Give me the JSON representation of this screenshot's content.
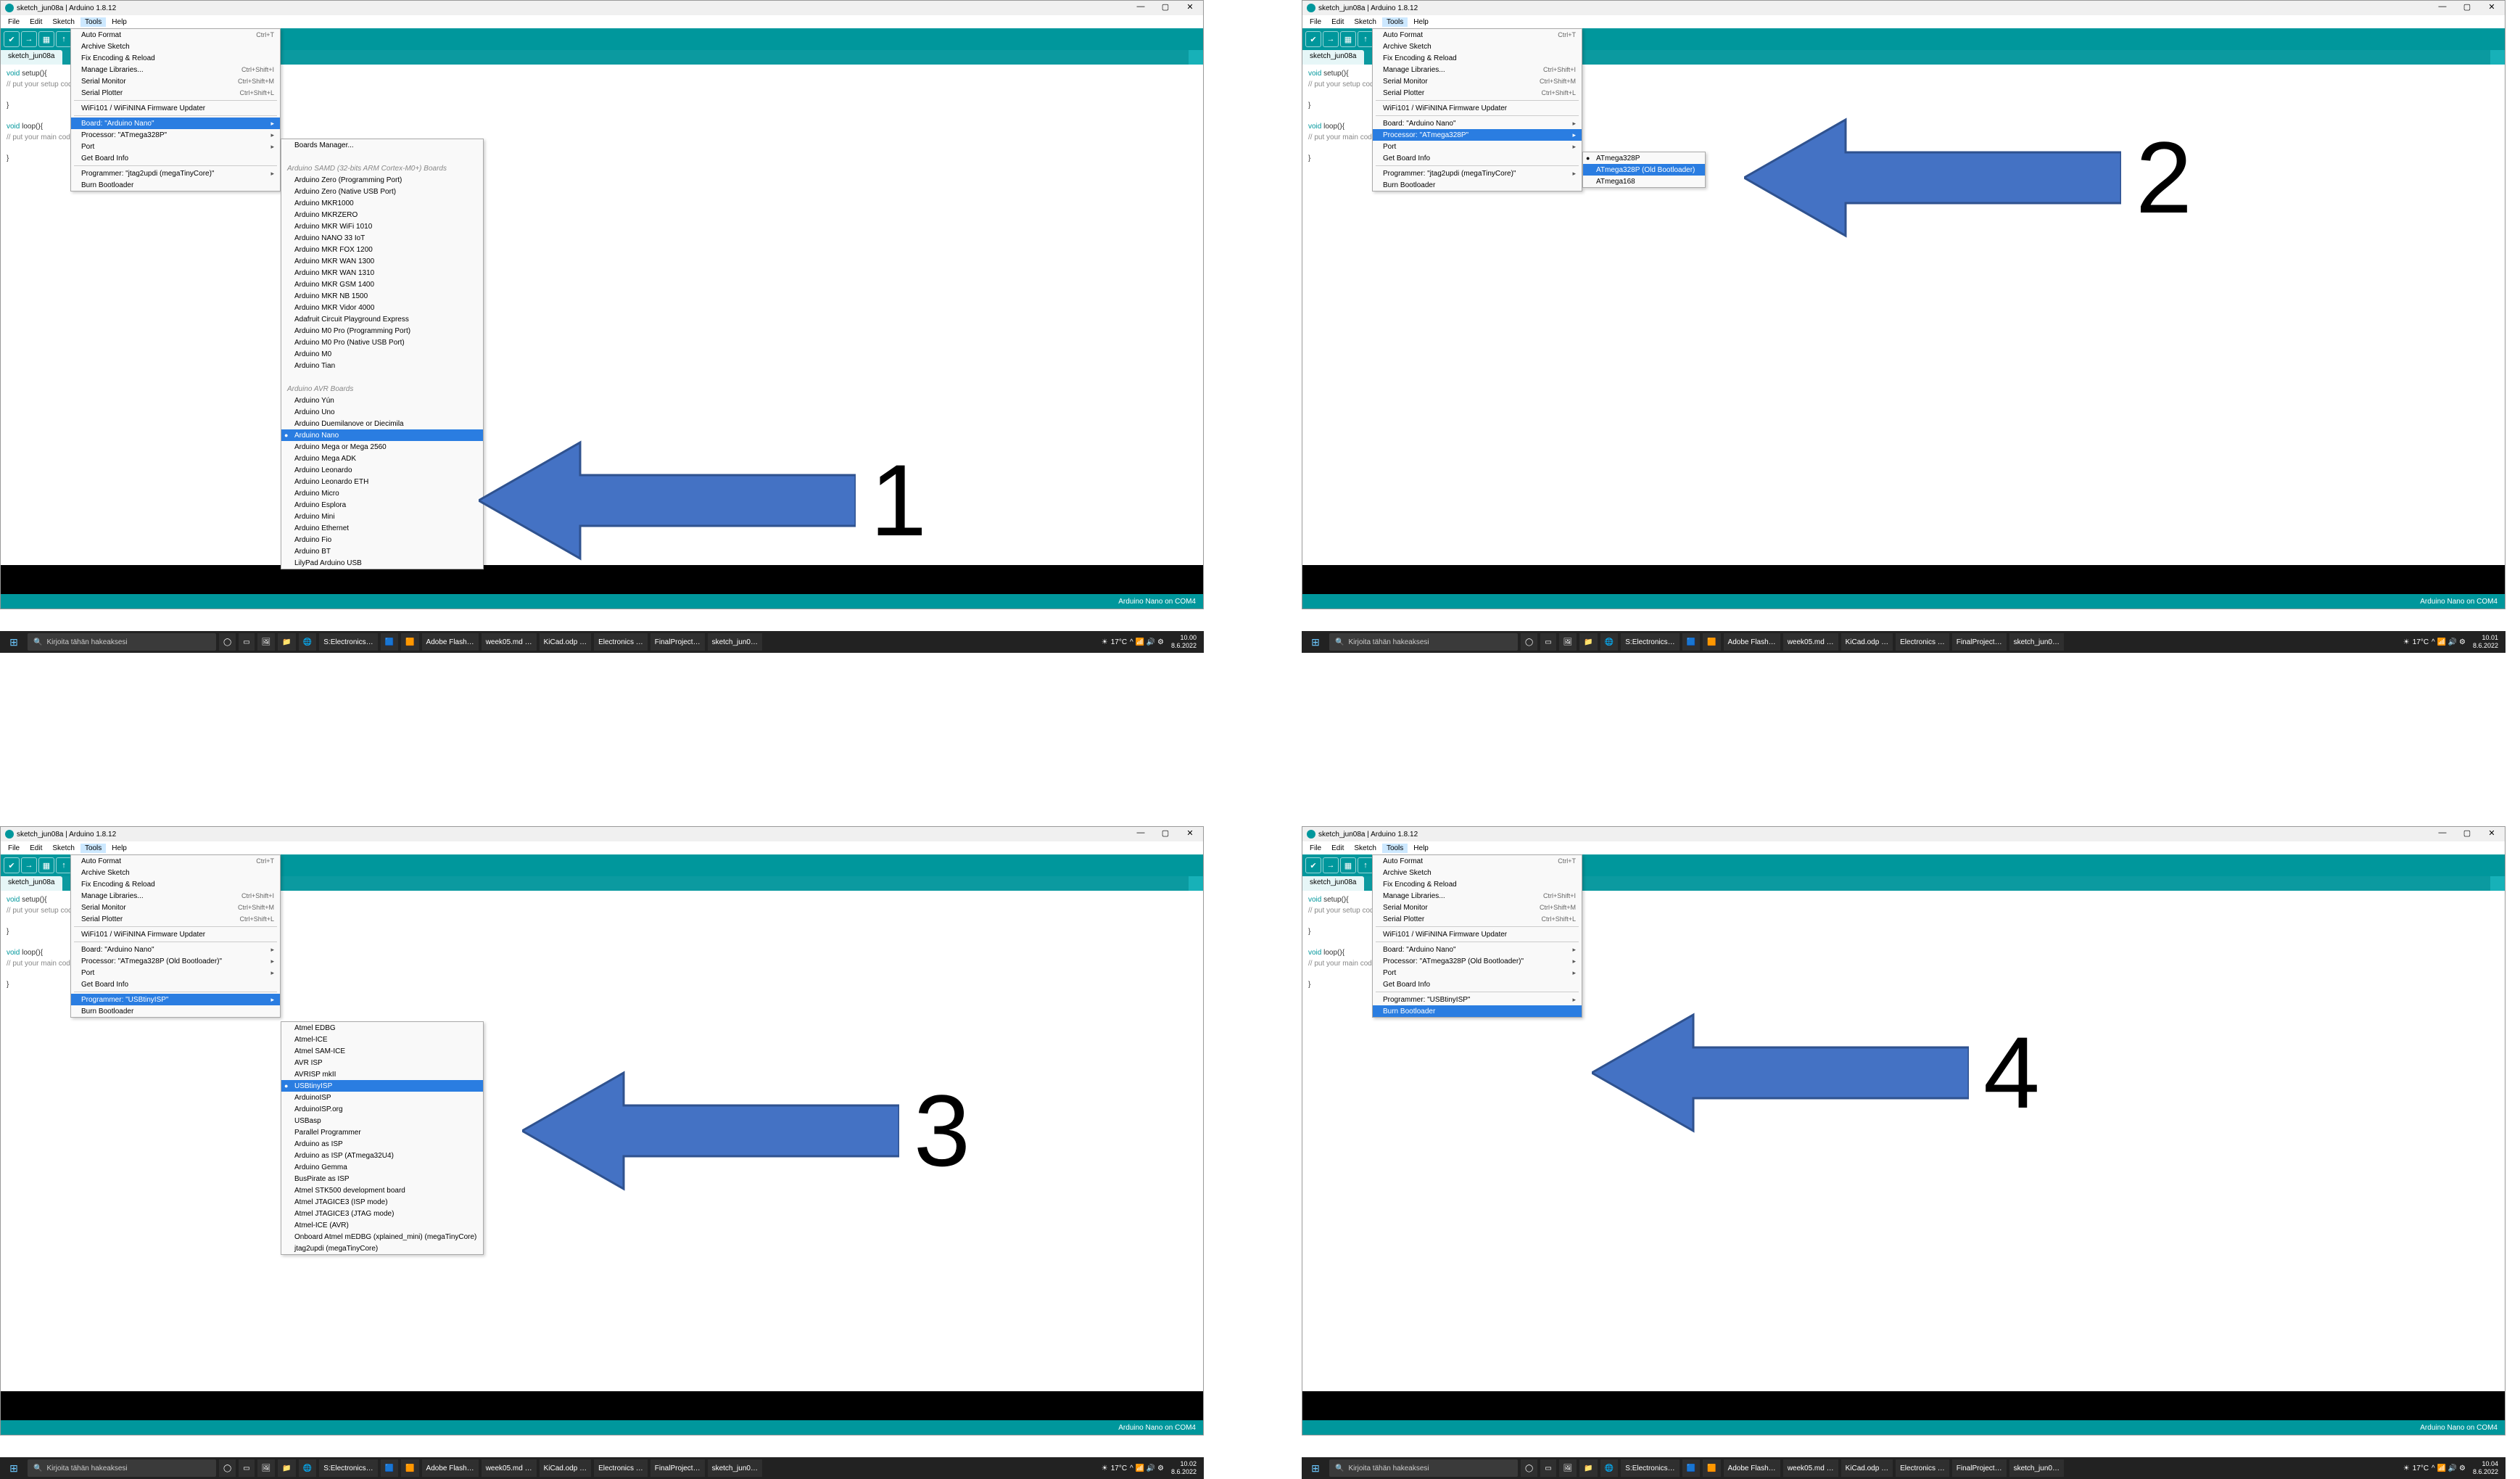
{
  "app_title": "sketch_jun08a | Arduino 1.8.12",
  "menubar": [
    "File",
    "Edit",
    "Sketch",
    "Tools",
    "Help"
  ],
  "menubar_hi": "Tools",
  "tab_label": "sketch_jun08a",
  "status_text": "Arduino Nano on COM4",
  "code": {
    "l1a": "void ",
    "l1b": "setup()",
    "l1c": "{",
    "l2": "  // put your setup code here, to run once:",
    "l3": "",
    "l4": "}",
    "l5": "",
    "l6a": "void ",
    "l6b": "loop()",
    "l6c": "{",
    "l7": "  // put your main code here, to run repeatedly:",
    "l8": "",
    "l9": "}"
  },
  "tools_common": {
    "auto_format": "Auto Format",
    "auto_format_sc": "Ctrl+T",
    "archive": "Archive Sketch",
    "fix_enc": "Fix Encoding & Reload",
    "manage_lib": "Manage Libraries...",
    "manage_lib_sc": "Ctrl+Shift+I",
    "ser_mon": "Serial Monitor",
    "ser_mon_sc": "Ctrl+Shift+M",
    "ser_plot": "Serial Plotter",
    "ser_plot_sc": "Ctrl+Shift+L",
    "wifi": "WiFi101 / WiFiNINA Firmware Updater",
    "port": "Port",
    "get_board": "Get Board Info",
    "burn": "Burn Bootloader"
  },
  "panel1": {
    "board": "Board: \"Arduino Nano\"",
    "processor": "Processor: \"ATmega328P\"",
    "programmer": "Programmer: \"jtag2updi (megaTinyCore)\"",
    "sub_hdr1": "Boards Manager...",
    "sub_hdr2": "Arduino SAMD (32-bits ARM Cortex-M0+) Boards",
    "sub_hdr3": "Arduino AVR Boards",
    "samd": [
      "Arduino Zero (Programming Port)",
      "Arduino Zero (Native USB Port)",
      "Arduino MKR1000",
      "Arduino MKRZERO",
      "Arduino MKR WiFi 1010",
      "Arduino NANO 33 IoT",
      "Arduino MKR FOX 1200",
      "Arduino MKR WAN 1300",
      "Arduino MKR WAN 1310",
      "Arduino MKR GSM 1400",
      "Arduino MKR NB 1500",
      "Arduino MKR Vidor 4000",
      "Adafruit Circuit Playground Express",
      "Arduino M0 Pro (Programming Port)",
      "Arduino M0 Pro (Native USB Port)",
      "Arduino M0",
      "Arduino Tian"
    ],
    "avr": [
      "Arduino Yún",
      "Arduino Uno",
      "Arduino Duemilanove or Diecimila",
      "Arduino Nano",
      "Arduino Mega or Mega 2560",
      "Arduino Mega ADK",
      "Arduino Leonardo",
      "Arduino Leonardo ETH",
      "Arduino Micro",
      "Arduino Esplora",
      "Arduino Mini",
      "Arduino Ethernet",
      "Arduino Fio",
      "Arduino BT",
      "LilyPad Arduino USB"
    ],
    "avr_hi": "Arduino Nano"
  },
  "panel2": {
    "board": "Board: \"Arduino Nano\"",
    "processor": "Processor: \"ATmega328P\"",
    "programmer": "Programmer: \"jtag2updi (megaTinyCore)\"",
    "sub": [
      "ATmega328P",
      "ATmega328P (Old Bootloader)",
      "ATmega168"
    ],
    "sub_hi": "ATmega328P (Old Bootloader)",
    "sub_chk": "ATmega328P"
  },
  "panel3": {
    "board": "Board: \"Arduino Nano\"",
    "processor": "Processor: \"ATmega328P (Old Bootloader)\"",
    "programmer": "Programmer: \"USBtinyISP\"",
    "sub": [
      "Atmel EDBG",
      "Atmel-ICE",
      "Atmel SAM-ICE",
      "AVR ISP",
      "AVRISP mkII",
      "USBtinyISP",
      "ArduinoISP",
      "ArduinoISP.org",
      "USBasp",
      "Parallel Programmer",
      "Arduino as ISP",
      "Arduino as ISP (ATmega32U4)",
      "Arduino Gemma",
      "BusPirate as ISP",
      "Atmel STK500 development board",
      "Atmel JTAGICE3 (ISP mode)",
      "Atmel JTAGICE3 (JTAG mode)",
      "Atmel-ICE (AVR)",
      "Onboard Atmel mEDBG (xplained_mini) (megaTinyCore)",
      "jtag2updi (megaTinyCore)"
    ],
    "sub_hi": "USBtinyISP"
  },
  "panel4": {
    "board": "Board: \"Arduino Nano\"",
    "processor": "Processor: \"ATmega328P (Old Bootloader)\"",
    "programmer": "Programmer: \"USBtinyISP\"",
    "hi": "Burn Bootloader"
  },
  "taskbar": {
    "search_placeholder": "Kirjoita tähän hakeaksesi",
    "items": [
      "S:Electronics…",
      "",
      "",
      "Adobe Flash…",
      "week05.md …",
      "KiCad.odp …",
      "Electronics …",
      "FinalProject…",
      "sketch_jun0…"
    ],
    "weather": "17°C",
    "time1": "10.00",
    "date1": "8.6.2022",
    "time2": "10.01",
    "date2": "8.6.2022",
    "time3": "10.02",
    "date3": "8.6.2022",
    "time4": "10.04",
    "date4": "8.6.2022"
  },
  "annotations": {
    "a1": "1",
    "a2": "2",
    "a3": "3",
    "a4": "4"
  }
}
